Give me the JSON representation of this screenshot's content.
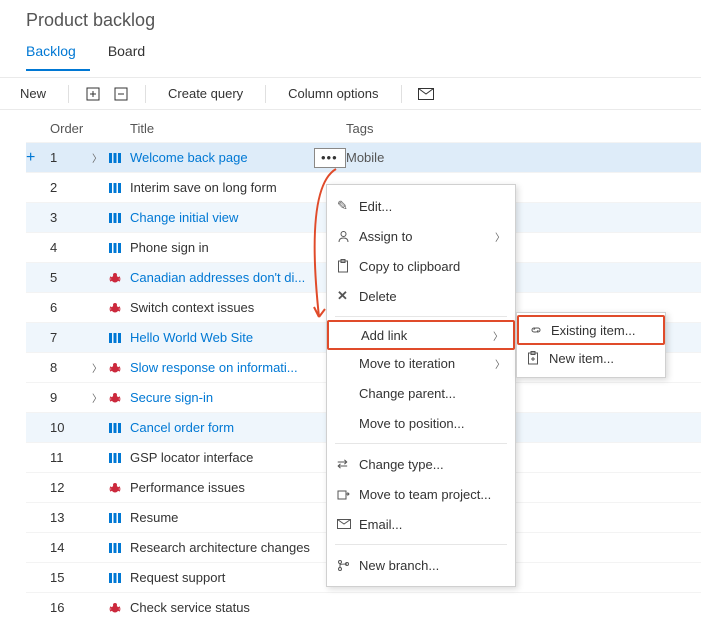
{
  "pageTitle": "Product backlog",
  "tabs": {
    "backlog": "Backlog",
    "board": "Board"
  },
  "toolbar": {
    "new": "New",
    "createQuery": "Create query",
    "columnOptions": "Column options"
  },
  "columns": {
    "order": "Order",
    "title": "Title",
    "tags": "Tags"
  },
  "rows": [
    {
      "order": 1,
      "chev": true,
      "type": "pbi",
      "title": "Welcome back page",
      "link": true,
      "selected": true,
      "showEllipsis": true,
      "tag": "Mobile"
    },
    {
      "order": 2,
      "type": "pbi",
      "title": "Interim save on long form"
    },
    {
      "order": 3,
      "type": "pbi",
      "title": "Change initial view",
      "link": true,
      "shaded": true
    },
    {
      "order": 4,
      "type": "pbi",
      "title": "Phone sign in"
    },
    {
      "order": 5,
      "type": "bug",
      "title": "Canadian addresses don't di...",
      "link": true,
      "shaded": true
    },
    {
      "order": 6,
      "type": "bug",
      "title": "Switch context issues"
    },
    {
      "order": 7,
      "type": "pbi",
      "title": "Hello World Web Site",
      "link": true,
      "shaded": true
    },
    {
      "order": 8,
      "chev": true,
      "type": "bug",
      "title": "Slow response on informati...",
      "link": true
    },
    {
      "order": 9,
      "chev": true,
      "type": "bug",
      "title": "Secure sign-in",
      "link": true
    },
    {
      "order": 10,
      "type": "pbi",
      "title": "Cancel order form",
      "link": true,
      "shaded": true
    },
    {
      "order": 11,
      "type": "pbi",
      "title": "GSP locator interface"
    },
    {
      "order": 12,
      "type": "bug",
      "title": "Performance issues"
    },
    {
      "order": 13,
      "type": "pbi",
      "title": "Resume"
    },
    {
      "order": 14,
      "type": "pbi",
      "title": "Research architecture changes"
    },
    {
      "order": 15,
      "type": "pbi",
      "title": "Request support"
    },
    {
      "order": 16,
      "type": "bug",
      "title": "Check service status"
    }
  ],
  "contextMenu": {
    "edit": "Edit...",
    "assignTo": "Assign to",
    "copy": "Copy to clipboard",
    "delete": "Delete",
    "addLink": "Add link",
    "moveIteration": "Move to iteration",
    "changeParent": "Change parent...",
    "moveToPosition": "Move to position...",
    "changeType": "Change type...",
    "moveToTeam": "Move to team project...",
    "email": "Email...",
    "newBranch": "New branch..."
  },
  "submenu": {
    "existing": "Existing item...",
    "new": "New item..."
  }
}
